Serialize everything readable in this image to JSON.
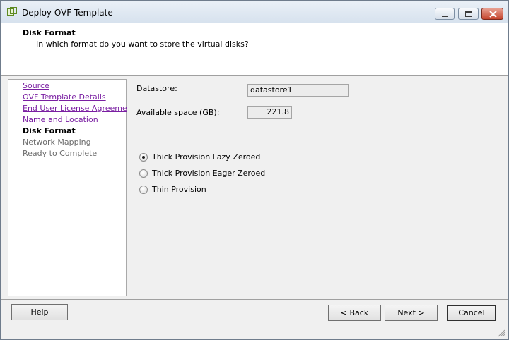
{
  "window": {
    "title": "Deploy OVF Template",
    "controls": [
      "minimize-icon",
      "maximize-icon",
      "close-icon"
    ]
  },
  "header": {
    "title": "Disk Format",
    "subtitle": "In which format do you want to store the virtual disks?"
  },
  "nav": {
    "items": [
      {
        "label": "Source",
        "state": "link"
      },
      {
        "label": "OVF Template Details",
        "state": "link"
      },
      {
        "label": "End User License Agreement",
        "state": "link"
      },
      {
        "label": "Name and Location",
        "state": "link"
      },
      {
        "label": "Disk Format",
        "state": "current"
      },
      {
        "label": "Network Mapping",
        "state": "disabled"
      },
      {
        "label": "Ready to Complete",
        "state": "disabled"
      }
    ]
  },
  "main": {
    "datastore_label": "Datastore:",
    "datastore_value": "datastore1",
    "space_label": "Available space (GB):",
    "space_value": "221.8",
    "options": [
      {
        "label": "Thick Provision Lazy Zeroed",
        "selected": true
      },
      {
        "label": "Thick Provision Eager Zeroed",
        "selected": false
      },
      {
        "label": "Thin Provision",
        "selected": false
      }
    ]
  },
  "footer": {
    "help": "Help",
    "back": "< Back",
    "next": "Next >",
    "cancel": "Cancel"
  },
  "colors": {
    "link": "#7a1fa2",
    "disabled": "#6d6d6d",
    "close_button": "#c5442d"
  }
}
